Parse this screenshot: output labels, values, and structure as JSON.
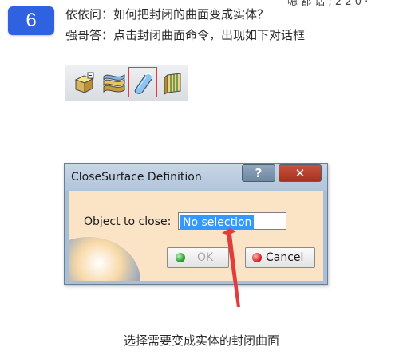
{
  "step": {
    "number": "6"
  },
  "header": {
    "cut_text": "嗯  都 话 ; 2 2 0 ·",
    "question": "依依问：如何把封闭的曲面变成实体？",
    "answer": "强哥答：点击封闭曲面命令，出现如下对话框"
  },
  "toolbar": {
    "icons": [
      "solid-box-icon",
      "thick-surface-icon",
      "close-surface-icon",
      "sew-surface-icon"
    ],
    "highlight_color": "#e23c3c"
  },
  "dialog": {
    "title": "CloseSurface Definition",
    "help_label": "?",
    "close_label": "✕",
    "field_label": "Object to close:",
    "field_value": "No selection",
    "ok_label": "OK",
    "cancel_label": "Cancel"
  },
  "annotation": {
    "color": "#e23c3c"
  },
  "caption": "选择需要变成实体的封闭曲面",
  "colors": {
    "badge": "#2e62e0",
    "dialog_frame": "#a9bfd8",
    "dialog_client": "#fbe4c6",
    "selection": "#3399ff"
  }
}
